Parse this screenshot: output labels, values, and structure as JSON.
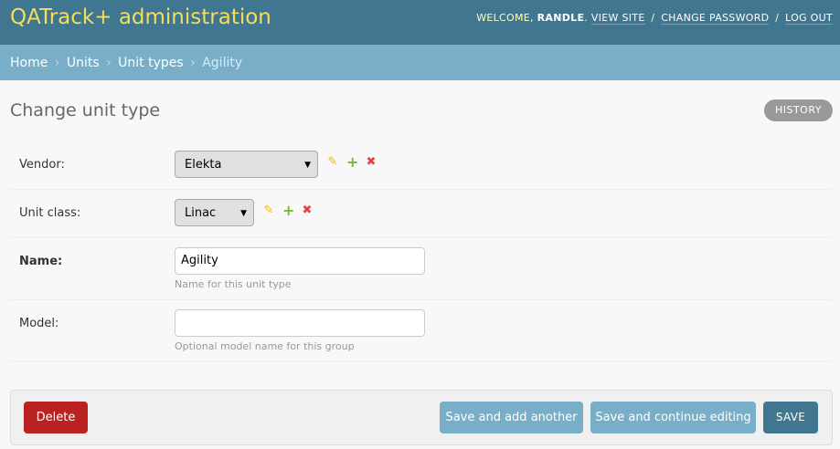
{
  "header": {
    "brand": "QATrack+ administration",
    "welcome": "WELCOME,",
    "username": "RANDLE",
    "view_site": "VIEW SITE",
    "change_password": "CHANGE PASSWORD",
    "log_out": "LOG OUT",
    "separator": "/"
  },
  "breadcrumbs": {
    "items": [
      "Home",
      "Units",
      "Unit types"
    ],
    "current": "Agility",
    "separator": "›"
  },
  "page": {
    "title": "Change unit type",
    "history_label": "HISTORY"
  },
  "form": {
    "vendor": {
      "label": "Vendor:",
      "value": "Elekta"
    },
    "unit_class": {
      "label": "Unit class:",
      "value": "Linac"
    },
    "name": {
      "label": "Name:",
      "value": "Agility",
      "help": "Name for this unit type"
    },
    "model": {
      "label": "Model:",
      "value": "",
      "help": "Optional model name for this group"
    },
    "icons": {
      "edit": "✎",
      "add": "+",
      "delete": "✖",
      "dropdown": "▼"
    }
  },
  "submit": {
    "delete_label": "Delete",
    "save_add_another_label": "Save and add another",
    "save_continue_label": "Save and continue editing",
    "save_label": "SAVE"
  },
  "colors": {
    "header_bg": "#417690",
    "brand": "#f5dd5d",
    "breadcrumb_bg": "#79aec8",
    "delete_button": "#ba2121",
    "primary_button": "#417690",
    "secondary_button": "#79aec8"
  }
}
